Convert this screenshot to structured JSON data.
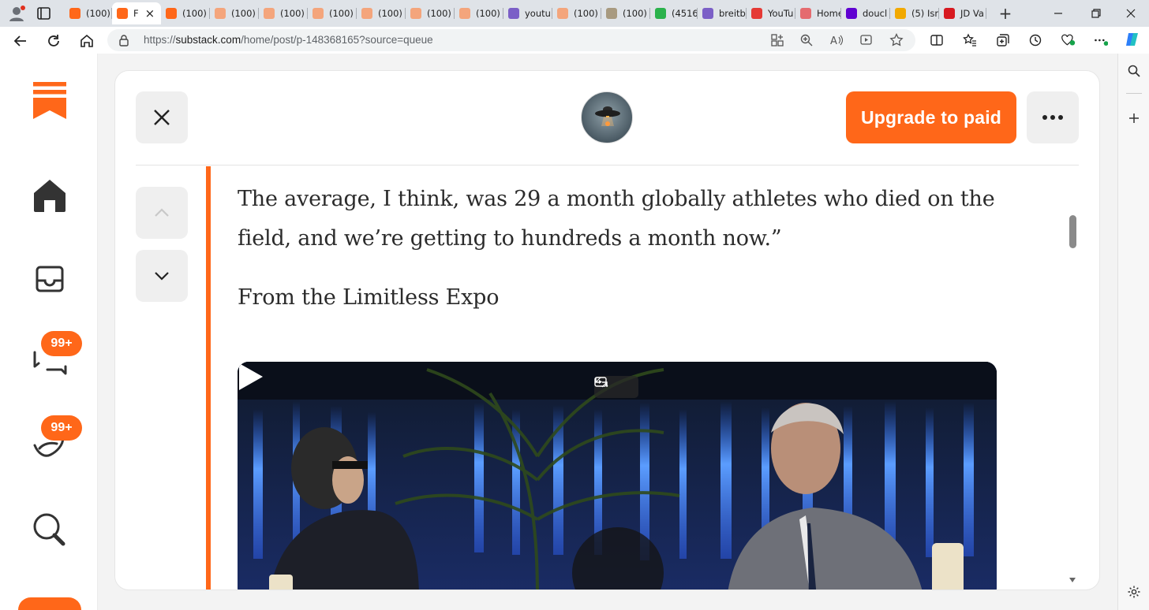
{
  "browser": {
    "tabs": [
      {
        "label": "(100)",
        "icon": "substack-icon",
        "color": "#ff6719"
      },
      {
        "label": "F",
        "icon": "substack-icon",
        "color": "#ff6719",
        "active": true
      },
      {
        "label": "(100)",
        "icon": "substack-icon",
        "color": "#ff6719"
      },
      {
        "label": "(100)",
        "icon": "substack-icon",
        "color": "#f4a57c"
      },
      {
        "label": "(100)",
        "icon": "substack-icon",
        "color": "#f4a57c"
      },
      {
        "label": "(100)",
        "icon": "substack-icon",
        "color": "#f4a57c"
      },
      {
        "label": "(100)",
        "icon": "substack-icon",
        "color": "#f4a57c"
      },
      {
        "label": "(100)",
        "icon": "substack-icon",
        "color": "#f4a57c"
      },
      {
        "label": "(100)",
        "icon": "substack-icon",
        "color": "#f4a57c"
      },
      {
        "label": "youtu",
        "icon": "yahoo-icon",
        "color": "#7b5fc7"
      },
      {
        "label": "(100)",
        "icon": "substack-icon",
        "color": "#f4a57c"
      },
      {
        "label": "(100)",
        "icon": "image-icon",
        "color": "#a89a80"
      },
      {
        "label": "(4516",
        "icon": "g-icon",
        "color": "#2bb24c"
      },
      {
        "label": "breitb",
        "icon": "yahoo-icon",
        "color": "#7b5fc7"
      },
      {
        "label": "YouTu",
        "icon": "youtube-icon",
        "color": "#e53935"
      },
      {
        "label": "Home",
        "icon": "home-site-icon",
        "color": "#e56b6f"
      },
      {
        "label": "doucl",
        "icon": "yahoo-icon",
        "color": "#5f01d1"
      },
      {
        "label": "(5) Isr",
        "icon": "nbc-icon",
        "color": "#f2a900"
      },
      {
        "label": "JD Va",
        "icon": "n-icon",
        "color": "#d71920"
      }
    ],
    "url_prefix": "https://",
    "url_host": "substack.com",
    "url_path": "/home/post/p-148368165?source=queue"
  },
  "nav": {
    "badge_chat": "99+",
    "badge_activity": "99+"
  },
  "post": {
    "upgrade_label": "Upgrade to paid",
    "quote_line_1": "The average, I think, was 29 a month globally athletes who died on the",
    "quote_line_2": "field, and we’re getting to hundreds a month now.”",
    "subheading": "From the Limitless Expo"
  },
  "colors": {
    "accent": "#ff6719",
    "text": "#2b2b2b"
  }
}
